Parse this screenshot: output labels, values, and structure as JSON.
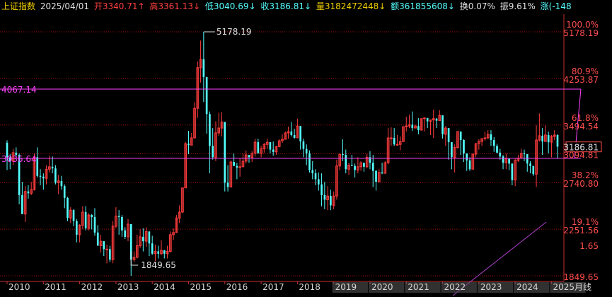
{
  "topbar": {
    "index_name": "上证指数",
    "date": "2025/04/01",
    "open": "开3340.71↑",
    "high": "高3361.13↓",
    "low": "低3040.69↓",
    "close": "收3186.81↓",
    "volume": "量3182472448↓",
    "amount": "额361855608↓",
    "turnover": "换0.07%",
    "amplitude": "振9.61%",
    "change": "涨(-148"
  },
  "colors": {
    "up": "#ff3c3c",
    "down": "#54ffff",
    "dotted_line": "#a01010",
    "magenta": "#ff44ff",
    "purple_line": "#b040d0",
    "axis_text": "#ff4d4d",
    "marker_text": "#e0e0e0"
  },
  "chart_data": {
    "type": "candlestick",
    "period": "monthly",
    "yscale": "log",
    "y_range": [
      1849.65,
      5178.19
    ],
    "levels": [
      {
        "value": 5178.19,
        "pct": "100.0%"
      },
      {
        "value": 4253.87,
        "pct": "80.9%"
      },
      {
        "value": 3494.54,
        "pct": "61.8%"
      },
      {
        "value": 3094.81,
        "pct": ""
      },
      {
        "value": 2740.8,
        "pct": "38.2%"
      },
      {
        "value": 2251.56,
        "pct": "19.1%"
      },
      {
        "value": 1849.65,
        "pct": ""
      }
    ],
    "ytick_extra": "1.65",
    "current_price": "3186.81",
    "markers": {
      "high": "5178.19",
      "low": "1849.65"
    },
    "hlines": [
      {
        "value": 4067.14,
        "label": "4067.14"
      },
      {
        "value": 3036.64,
        "label": "3036.64"
      }
    ],
    "years": [
      "2010",
      "2011",
      "2012",
      "2013",
      "2014",
      "2015",
      "2016",
      "2017",
      "2018",
      "2019",
      "2020",
      "2021",
      "2022",
      "2023",
      "2024",
      "2025"
    ],
    "freq_label": "月线",
    "candles": [
      [
        3243,
        3277,
        2890,
        3050
      ],
      [
        3050,
        3090,
        2900,
        3000
      ],
      [
        3000,
        3160,
        2950,
        3110
      ],
      [
        3110,
        3180,
        3050,
        3080
      ],
      [
        3080,
        3100,
        2500,
        2600
      ],
      [
        2600,
        2750,
        2480,
        2400
      ],
      [
        2400,
        2700,
        2320,
        2640
      ],
      [
        2640,
        2710,
        2560,
        2620
      ],
      [
        2620,
        2750,
        2600,
        2660
      ],
      [
        2660,
        3100,
        2650,
        3050
      ],
      [
        3050,
        3180,
        2800,
        2820
      ],
      [
        2820,
        2900,
        2710,
        2810
      ],
      [
        2810,
        2850,
        2660,
        2790
      ],
      [
        2790,
        2950,
        2720,
        2900
      ],
      [
        2900,
        3070,
        2860,
        2930
      ],
      [
        2930,
        3060,
        2850,
        2910
      ],
      [
        2910,
        2950,
        2720,
        2740
      ],
      [
        2740,
        2830,
        2610,
        2760
      ],
      [
        2760,
        2820,
        2660,
        2700
      ],
      [
        2700,
        2720,
        2460,
        2570
      ],
      [
        2570,
        2580,
        2330,
        2360
      ],
      [
        2360,
        2470,
        2310,
        2440
      ],
      [
        2440,
        2450,
        2280,
        2330
      ],
      [
        2330,
        2350,
        2130,
        2200
      ],
      [
        2200,
        2300,
        2130,
        2290
      ],
      [
        2290,
        2480,
        2250,
        2420
      ],
      [
        2420,
        2480,
        2240,
        2260
      ],
      [
        2260,
        2410,
        2240,
        2390
      ],
      [
        2390,
        2400,
        2250,
        2370
      ],
      [
        2370,
        2460,
        2190,
        2220
      ],
      [
        2220,
        2290,
        2100,
        2100
      ],
      [
        2100,
        2200,
        2040,
        2140
      ],
      [
        2140,
        2140,
        2010,
        2070
      ],
      [
        2070,
        2110,
        1950,
        2070
      ],
      [
        2070,
        2100,
        1960,
        1980
      ],
      [
        1980,
        2330,
        1950,
        2280
      ],
      [
        2280,
        2470,
        2260,
        2380
      ],
      [
        2380,
        2440,
        2200,
        2370
      ],
      [
        2370,
        2390,
        2180,
        2240
      ],
      [
        2240,
        2270,
        2160,
        2180
      ],
      [
        2180,
        2350,
        2140,
        2300
      ],
      [
        2300,
        2290,
        1850,
        1980
      ],
      [
        1980,
        2050,
        1960,
        2000
      ],
      [
        2000,
        2200,
        1990,
        2100
      ],
      [
        2100,
        2250,
        2080,
        2180
      ],
      [
        2180,
        2260,
        2050,
        2140
      ],
      [
        2140,
        2270,
        2090,
        2230
      ],
      [
        2230,
        2220,
        2010,
        2120
      ],
      [
        2120,
        2190,
        2020,
        2030
      ],
      [
        2030,
        2110,
        1970,
        2050
      ],
      [
        2050,
        2100,
        1990,
        2030
      ],
      [
        2030,
        2150,
        2020,
        2060
      ],
      [
        2060,
        2060,
        1990,
        2030
      ],
      [
        2030,
        2100,
        1990,
        2050
      ],
      [
        2050,
        2230,
        2040,
        2200
      ],
      [
        2200,
        2260,
        2150,
        2220
      ],
      [
        2220,
        2390,
        2230,
        2360
      ],
      [
        2360,
        2490,
        2310,
        2420
      ],
      [
        2420,
        2680,
        2410,
        2680
      ],
      [
        2680,
        3250,
        2710,
        3230
      ],
      [
        3230,
        3410,
        3090,
        3210
      ],
      [
        3210,
        3380,
        3210,
        3310
      ],
      [
        3310,
        3850,
        3300,
        3750
      ],
      [
        3750,
        4570,
        3600,
        4450
      ],
      [
        4450,
        4990,
        4180,
        4610
      ],
      [
        4610,
        5178,
        3850,
        4280
      ],
      [
        4280,
        4100,
        3370,
        3660
      ],
      [
        3660,
        3700,
        2850,
        3200
      ],
      [
        3200,
        3450,
        3020,
        3050
      ],
      [
        3050,
        3550,
        3000,
        3380
      ],
      [
        3380,
        3680,
        3340,
        3450
      ],
      [
        3450,
        3690,
        3330,
        3540
      ],
      [
        3540,
        3540,
        2640,
        2740
      ],
      [
        2740,
        2950,
        2640,
        2690
      ],
      [
        2690,
        3010,
        2730,
        2990
      ],
      [
        2990,
        3100,
        2960,
        2940
      ],
      [
        2940,
        2980,
        2780,
        2920
      ],
      [
        2920,
        3040,
        2810,
        2930
      ],
      [
        2930,
        3100,
        2950,
        3000
      ],
      [
        3000,
        3140,
        2970,
        3080
      ],
      [
        3080,
        3040,
        2980,
        3050
      ],
      [
        3050,
        3130,
        2990,
        3100
      ],
      [
        3100,
        3300,
        3060,
        3250
      ],
      [
        3250,
        3300,
        3100,
        3100
      ],
      [
        3100,
        3200,
        3050,
        3160
      ],
      [
        3160,
        3240,
        3110,
        3220
      ],
      [
        3220,
        3300,
        3160,
        3250
      ],
      [
        3250,
        3200,
        3100,
        3150
      ],
      [
        3150,
        3260,
        3070,
        3120
      ],
      [
        3120,
        3200,
        3080,
        3190
      ],
      [
        3190,
        3290,
        3180,
        3270
      ],
      [
        3270,
        3360,
        3240,
        3290
      ],
      [
        3290,
        3400,
        3310,
        3380
      ],
      [
        3380,
        3470,
        3300,
        3400
      ],
      [
        3400,
        3540,
        3330,
        3350
      ],
      [
        3350,
        3440,
        3300,
        3310
      ],
      [
        3310,
        3590,
        3400,
        3480
      ],
      [
        3480,
        3420,
        3150,
        3260
      ],
      [
        3260,
        3300,
        3050,
        3160
      ],
      [
        3160,
        3220,
        2950,
        3100
      ],
      [
        3100,
        3140,
        2860,
        2890
      ],
      [
        2890,
        3000,
        2780,
        2850
      ],
      [
        2850,
        2900,
        2710,
        2780
      ],
      [
        2780,
        2860,
        2650,
        2720
      ],
      [
        2720,
        2850,
        2480,
        2600
      ],
      [
        2600,
        2750,
        2450,
        2550
      ],
      [
        2550,
        2700,
        2440,
        2590
      ],
      [
        2590,
        2660,
        2440,
        2490
      ],
      [
        2490,
        2640,
        2450,
        2590
      ],
      [
        2590,
        3020,
        2550,
        2940
      ],
      [
        2940,
        3100,
        2890,
        3090
      ],
      [
        3090,
        3290,
        3000,
        3080
      ],
      [
        3080,
        3150,
        2850,
        2900
      ],
      [
        2900,
        2980,
        2830,
        2950
      ],
      [
        2950,
        3080,
        2940,
        2940
      ],
      [
        2940,
        2970,
        2800,
        2890
      ],
      [
        2890,
        3050,
        2850,
        2930
      ],
      [
        2930,
        3000,
        2880,
        2980
      ],
      [
        2980,
        2950,
        2870,
        2930
      ],
      [
        2930,
        3090,
        2910,
        3050
      ],
      [
        3050,
        3130,
        2900,
        2980
      ],
      [
        2980,
        3080,
        2690,
        2880
      ],
      [
        2880,
        2890,
        2650,
        2750
      ],
      [
        2750,
        2900,
        2760,
        2860
      ],
      [
        2860,
        2980,
        2840,
        2850
      ],
      [
        2850,
        3000,
        2900,
        2980
      ],
      [
        2980,
        3450,
        2960,
        3310
      ],
      [
        3310,
        3460,
        3200,
        3310
      ],
      [
        3310,
        3450,
        3200,
        3220
      ],
      [
        3220,
        3350,
        3200,
        3220
      ],
      [
        3220,
        3330,
        3140,
        3260
      ],
      [
        3260,
        3470,
        3250,
        3470
      ],
      [
        3470,
        3620,
        3400,
        3480
      ],
      [
        3480,
        3650,
        3450,
        3500
      ],
      [
        3500,
        3700,
        3410,
        3450
      ],
      [
        3450,
        3500,
        3450,
        3480
      ],
      [
        3480,
        3600,
        3360,
        3420
      ],
      [
        3420,
        3530,
        3460,
        3590
      ],
      [
        3590,
        3610,
        3400,
        3600
      ],
      [
        3600,
        3580,
        3450,
        3550
      ],
      [
        3550,
        3550,
        3350,
        3570
      ],
      [
        3570,
        3730,
        3310,
        3590
      ],
      [
        3590,
        3600,
        3450,
        3560
      ],
      [
        3560,
        3720,
        3560,
        3640
      ],
      [
        3640,
        3450,
        3300,
        3360
      ],
      [
        3360,
        3480,
        3200,
        3450
      ],
      [
        3450,
        3380,
        3020,
        3250
      ],
      [
        3250,
        3130,
        2900,
        3050
      ],
      [
        3050,
        3220,
        2860,
        3180
      ],
      [
        3180,
        3390,
        3160,
        3400
      ],
      [
        3400,
        3290,
        3080,
        3280
      ],
      [
        3280,
        3290,
        2990,
        3100
      ],
      [
        3100,
        3100,
        2880,
        3010
      ],
      [
        3010,
        3050,
        2880,
        2900
      ],
      [
        2900,
        3100,
        2900,
        3090
      ],
      [
        3090,
        3240,
        3050,
        3230
      ],
      [
        3230,
        3290,
        3150,
        3260
      ],
      [
        3260,
        3300,
        3200,
        3300
      ],
      [
        3300,
        3400,
        3270,
        3310
      ],
      [
        3310,
        3420,
        3290,
        3360
      ],
      [
        3360,
        3420,
        3200,
        3280
      ],
      [
        3280,
        3320,
        3120,
        3200
      ],
      [
        3200,
        3230,
        3100,
        3110
      ],
      [
        3110,
        3160,
        3020,
        3060
      ],
      [
        3060,
        3080,
        2900,
        2980
      ],
      [
        2980,
        3100,
        2900,
        3030
      ],
      [
        3030,
        3030,
        2890,
        2970
      ],
      [
        2970,
        2960,
        2710,
        2770
      ],
      [
        2770,
        3030,
        2700,
        3010
      ],
      [
        3010,
        3080,
        2990,
        3040
      ],
      [
        3040,
        3160,
        3030,
        3100
      ],
      [
        3100,
        3150,
        3000,
        3090
      ],
      [
        3090,
        3000,
        2870,
        2970
      ],
      [
        2970,
        3000,
        2850,
        2940
      ],
      [
        2940,
        2900,
        2820,
        2840
      ],
      [
        2840,
        3490,
        2690,
        3280
      ],
      [
        3280,
        3670,
        3260,
        3340
      ],
      [
        3340,
        3450,
        3080,
        3260
      ],
      [
        3260,
        3490,
        3280,
        3350
      ],
      [
        3350,
        3400,
        3100,
        3250
      ],
      [
        3250,
        3350,
        3050,
        3330
      ],
      [
        3330,
        3420,
        3280,
        3350
      ],
      [
        3350,
        3360,
        3040,
        3190
      ]
    ]
  }
}
